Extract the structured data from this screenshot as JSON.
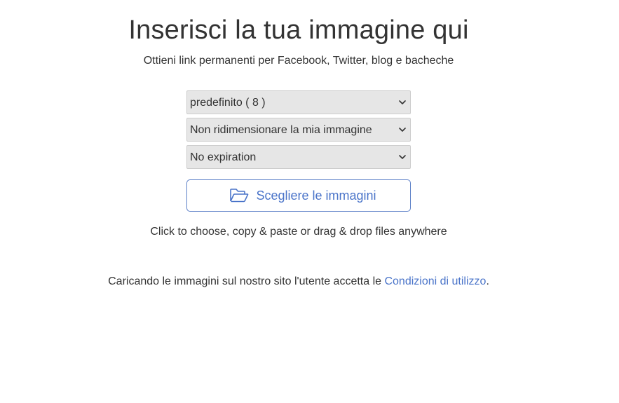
{
  "header": {
    "title": "Inserisci la tua immagine qui",
    "subtitle": "Ottieni link permanenti per Facebook, Twitter, blog e bacheche"
  },
  "options": {
    "category": {
      "selected": "predefinito ( 8 )"
    },
    "resize": {
      "selected": "Non ridimensionare la mia immagine"
    },
    "expiration": {
      "selected": "No expiration"
    }
  },
  "upload": {
    "button_label": "Scegliere le immagini",
    "icon": "folder-open-icon",
    "hint": "Click to choose, copy & paste or drag & drop files anywhere"
  },
  "terms": {
    "prefix": "Caricando le immagini sul nostro sito l'utente accetta le ",
    "link_label": "Condizioni di utilizzo",
    "suffix": "."
  },
  "colors": {
    "accent": "#4a74c9",
    "text": "#333333",
    "select_background": "#e6e6e6"
  }
}
